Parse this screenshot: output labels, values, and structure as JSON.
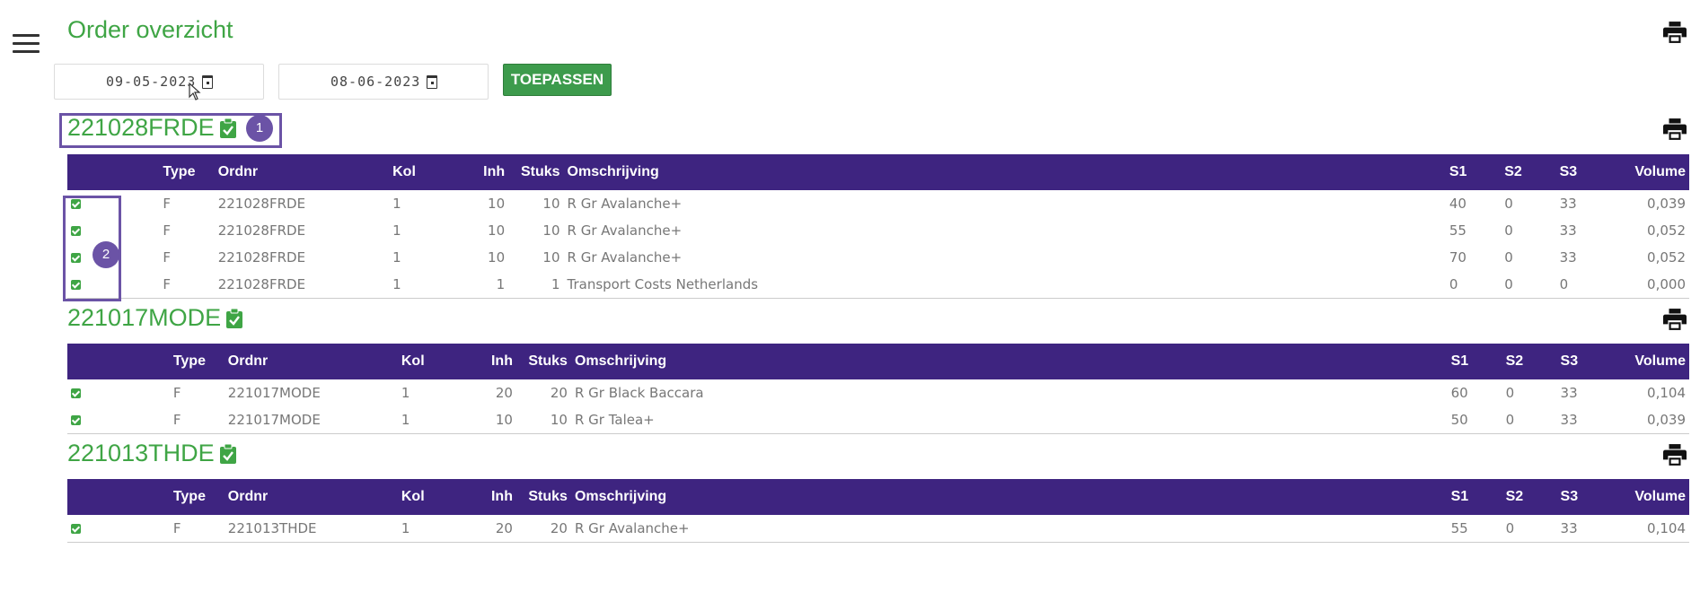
{
  "page": {
    "title": "Order overzicht"
  },
  "filters": {
    "date_from": "09-05-2023",
    "date_to": "08-06-2023",
    "apply_label": "TOEPASSEN"
  },
  "columns": [
    "Type",
    "Ordnr",
    "Kol",
    "Inh",
    "Stuks",
    "Omschrijving",
    "S1",
    "S2",
    "S3",
    "Volume"
  ],
  "annotations": [
    "1",
    "2"
  ],
  "orders": [
    {
      "id": "221028FRDE",
      "rows": [
        [
          "F",
          "221028FRDE",
          "1",
          "10",
          "10",
          "R Gr Avalanche+",
          "40",
          "0",
          "33",
          "0,039"
        ],
        [
          "F",
          "221028FRDE",
          "1",
          "10",
          "10",
          "R Gr Avalanche+",
          "55",
          "0",
          "33",
          "0,052"
        ],
        [
          "F",
          "221028FRDE",
          "1",
          "10",
          "10",
          "R Gr Avalanche+",
          "70",
          "0",
          "33",
          "0,052"
        ],
        [
          "F",
          "221028FRDE",
          "1",
          "1",
          "1",
          "Transport Costs Netherlands",
          "0",
          "0",
          "0",
          "0,000"
        ]
      ]
    },
    {
      "id": "221017MODE",
      "rows": [
        [
          "F",
          "221017MODE",
          "1",
          "20",
          "20",
          "R Gr Black Baccara",
          "60",
          "0",
          "33",
          "0,104"
        ],
        [
          "F",
          "221017MODE",
          "1",
          "10",
          "10",
          "R Gr Talea+",
          "50",
          "0",
          "33",
          "0,039"
        ]
      ]
    },
    {
      "id": "221013THDE",
      "rows": [
        [
          "F",
          "221013THDE",
          "1",
          "20",
          "20",
          "R Gr Avalanche+",
          "55",
          "0",
          "33",
          "0,104"
        ]
      ]
    }
  ],
  "colors": {
    "accent_green": "#3fa545",
    "header_purple": "#3e2480",
    "annotation_purple": "#6b53a6"
  },
  "icons": [
    "menu-icon",
    "print-icon",
    "calendar-icon",
    "clipboard-check-icon",
    "checkbox-checked-icon"
  ]
}
